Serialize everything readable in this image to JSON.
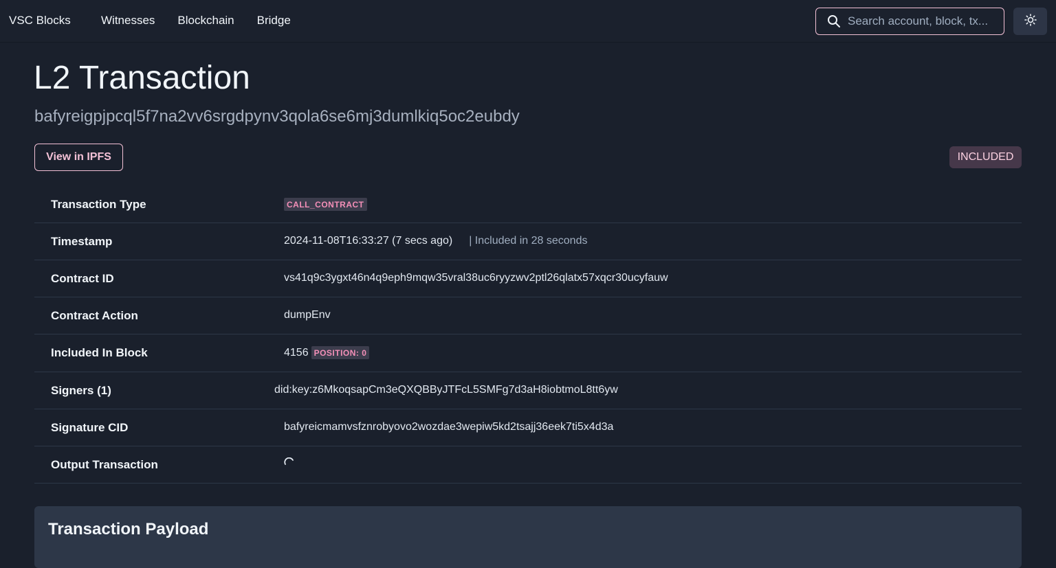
{
  "nav": {
    "brand": "VSC Blocks",
    "links": [
      "Witnesses",
      "Blockchain",
      "Bridge"
    ],
    "search_placeholder": "Search account, block, tx...",
    "search_icon": "search-icon",
    "theme_icon": "sun-icon"
  },
  "page": {
    "title": "L2 Transaction",
    "hash": "bafyreigpjpcql5f7na2vv6srgdpynv3qola6se6mj3dumlkiq5oc2eubdy",
    "ipfs_button": "View in IPFS",
    "status": "INCLUDED"
  },
  "details": {
    "type_label": "Transaction Type",
    "type_value": "CALL_CONTRACT",
    "timestamp_label": "Timestamp",
    "timestamp_value": "2024-11-08T16:33:27 (7 secs ago)",
    "timestamp_included": "| Included in 28 seconds",
    "contract_id_label": "Contract ID",
    "contract_id_value": "vs41q9c3ygxt46n4q9eph9mqw35vral38uc6ryyzwv2ptl26qlatx57xqcr30ucyfauw",
    "contract_action_label": "Contract Action",
    "contract_action_value": "dumpEnv",
    "block_label": "Included In Block",
    "block_value": "4156",
    "block_position": "POSITION: 0",
    "signers_label": "Signers (1)",
    "signers_value": "did:key:z6MkoqsapCm3eQXQBByJTFcL5SMFg7d3aH8iobtmoL8tt6yw",
    "signature_label": "Signature CID",
    "signature_value": "bafyreicmamvsfznrobyovo2wozdae3wepiw5kd2tsajj36eek7ti5x4d3a",
    "output_label": "Output Transaction",
    "output_icon": "spinner-icon"
  },
  "payload": {
    "title": "Transaction Payload"
  },
  "colors": {
    "background": "#1a202c",
    "accent": "#f3c1d6",
    "tag_text": "#f48fb8"
  }
}
